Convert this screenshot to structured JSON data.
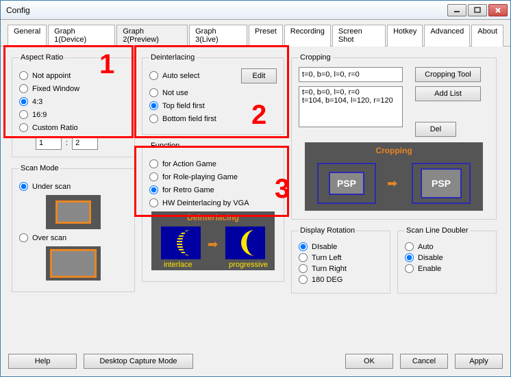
{
  "window": {
    "title": "Config"
  },
  "tabs": [
    "General",
    "Graph 1(Device)",
    "Graph 2(Preview)",
    "Graph 3(Live)",
    "Preset",
    "Recording",
    "Screen Shot",
    "Hotkey",
    "Advanced",
    "About"
  ],
  "active_tab": 2,
  "aspect_ratio": {
    "legend": "Aspect Ratio",
    "opts": [
      "Not appoint",
      "Fixed Window",
      "4:3",
      "16:9",
      "Custom Ratio"
    ],
    "selected": 2,
    "custom1": "1",
    "custom2": "2"
  },
  "scan_mode": {
    "legend": "Scan Mode",
    "opts": [
      "Under scan",
      "Over scan"
    ],
    "selected": 0
  },
  "deinterlacing": {
    "legend": "Deinterlacing",
    "opts": [
      "Auto select",
      "Not use",
      "Top field first",
      "Bottom field first"
    ],
    "selected": 2,
    "edit": "Edit"
  },
  "function": {
    "legend": "Function",
    "opts": [
      "for Action Game",
      "for Role-playing Game",
      "for Retro Game",
      "HW Deinterlacing by VGA"
    ],
    "selected": 2
  },
  "di_img": {
    "title": "Deinterlacing",
    "lbl_left": "interlace",
    "lbl_right": "progressive"
  },
  "cropping": {
    "legend": "Cropping",
    "input": "t=0, b=0, l=0, r=0",
    "list": "t=0, b=0, l=0, r=0\nt=104, b=104, l=120, r=120",
    "tool": "Cropping Tool",
    "add": "Add List",
    "del": "Del",
    "img_title": "Cropping",
    "psp": "PSP"
  },
  "display_rotation": {
    "legend": "Display Rotation",
    "opts": [
      "DIsable",
      "Turn Left",
      "Turn Right",
      "180 DEG"
    ],
    "selected": 0
  },
  "scan_line_doubler": {
    "legend": "Scan Line Doubler",
    "opts": [
      "Auto",
      "Disable",
      "Enable"
    ],
    "selected": 1
  },
  "annotations": {
    "one": "1",
    "two": "2",
    "three": "3"
  },
  "buttons": {
    "help": "Help",
    "desktop": "Desktop Capture Mode",
    "ok": "OK",
    "cancel": "Cancel",
    "apply": "Apply"
  }
}
